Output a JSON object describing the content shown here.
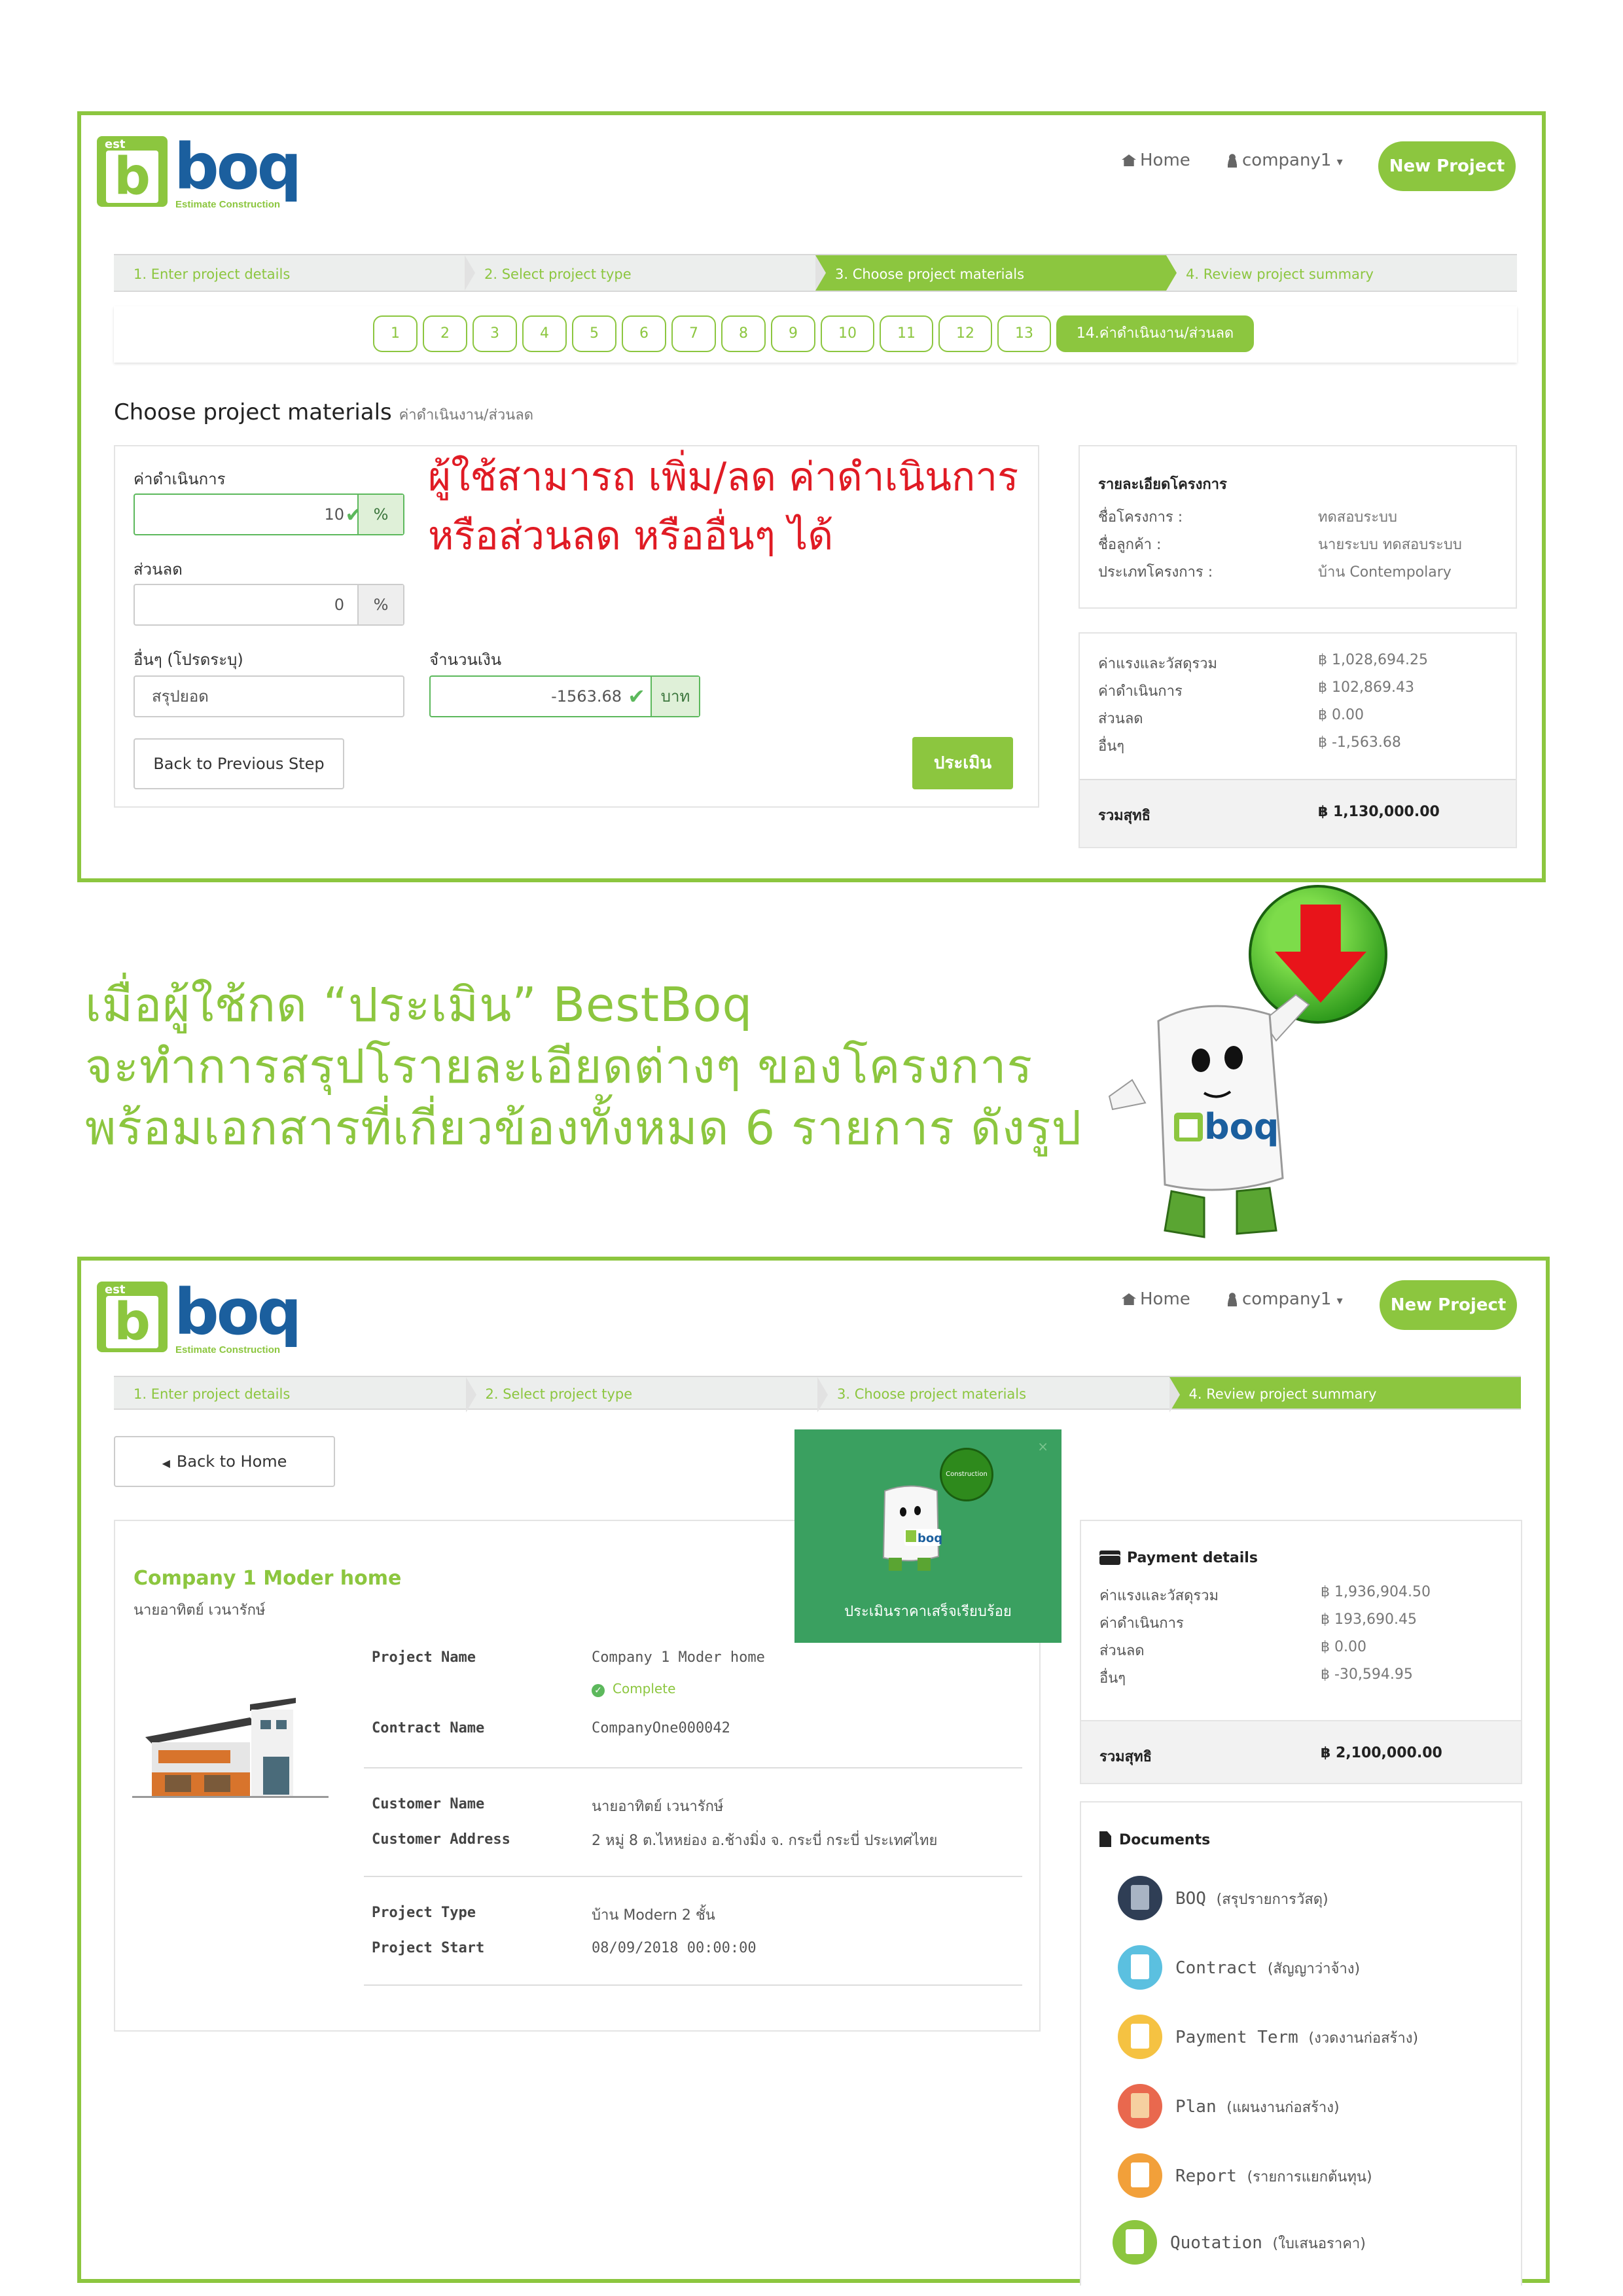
{
  "panel1": {
    "brand": {
      "badge_letter": "b",
      "badge_top": "est",
      "word": "boq",
      "tagline": "Estimate Construction"
    },
    "nav": {
      "home": "Home",
      "user": "company1",
      "user_caret": "▾",
      "new_project": "New Project"
    },
    "steps": [
      "1. Enter project details",
      "2. Select project type",
      "3. Choose project materials",
      "4. Review project summary"
    ],
    "active_step": 3,
    "pages": [
      "1",
      "2",
      "3",
      "4",
      "5",
      "6",
      "7",
      "8",
      "9",
      "10",
      "11",
      "12",
      "13",
      "14.ค่าดำเนินงาน/ส่วนลด"
    ],
    "active_page": 14,
    "title": "Choose project materials",
    "subtitle": "ค่าดำเนินงาน/ส่วนลด",
    "form": {
      "operation_label": "ค่าดำเนินการ",
      "operation_value": "10",
      "operation_unit": "%",
      "discount_label": "ส่วนลด",
      "discount_value": "0",
      "discount_unit": "%",
      "other_label": "อื่นๆ (โปรดระบุ)",
      "other_value": "สรุปยอด",
      "amount_label": "จำนวนเงิน",
      "amount_value": "-1563.68",
      "amount_unit": "บาท",
      "back_button": "Back to Previous Step",
      "evaluate_button": "ประเมิน"
    },
    "note": [
      "ผู้ใช้สามารถ เพิ่ม/ลด ค่าดำเนินการ",
      "หรือส่วนลด หรืออื่นๆ ได้"
    ],
    "project_info": {
      "heading": "รายละเอียดโครงการ",
      "rows": [
        {
          "k": "ชื่อโครงการ :",
          "v": "ทดสอบระบบ"
        },
        {
          "k": "ชื่อลูกค้า :",
          "v": "นายระบบ ทดสอบระบบ"
        },
        {
          "k": "ประเภทโครงการ :",
          "v": "บ้าน Contempolary"
        }
      ]
    },
    "costs": {
      "rows": [
        {
          "k": "ค่าแรงและวัสดุรวม",
          "v": "฿ 1,028,694.25"
        },
        {
          "k": "ค่าดำเนินการ",
          "v": "฿ 102,869.43"
        },
        {
          "k": "ส่วนลด",
          "v": "฿ 0.00"
        },
        {
          "k": "อื่นๆ",
          "v": "฿ -1,563.68"
        }
      ],
      "total_label": "รวมสุทธิ",
      "total_value": "฿ 1,130,000.00"
    }
  },
  "caption": [
    "เมื่อผู้ใช้กด “ประเมิน” BestBoq",
    "จะทำการสรุปโรายละเอียดต่างๆ ของโครงการ",
    "พร้อมเอกสารที่เกี่ยวข้องทั้งหมด 6 รายการ ดังรูป"
  ],
  "mascot": {
    "brand": "boq",
    "badge": "b"
  },
  "panel2": {
    "brand": {
      "badge_letter": "b",
      "badge_top": "est",
      "word": "boq",
      "tagline": "Estimate Construction"
    },
    "nav": {
      "home": "Home",
      "user": "company1",
      "user_caret": "▾",
      "new_project": "New Project"
    },
    "steps": [
      "1. Enter project details",
      "2. Select project type",
      "3. Choose project materials",
      "4. Review project summary"
    ],
    "active_step": 4,
    "back_home": "Back to Home",
    "toast": {
      "message": "ประเมินราคาเสร็จเรียบร้อย",
      "close": "×",
      "ball_text": "Construction"
    },
    "company": {
      "name": "Company 1 Moder home",
      "owner": "นายอาทิตย์ เวนารักษ์"
    },
    "details": [
      {
        "k": "Project Name",
        "v": "Company 1 Moder home"
      },
      {
        "k": "",
        "v": "Complete"
      },
      {
        "k": "Contract Name",
        "v": "CompanyOne000042"
      },
      {
        "k": "Customer Name",
        "v": "นายอาทิตย์ เวนารักษ์"
      },
      {
        "k": "Customer Address",
        "v": "2 หมู่ 8 ต.ไหหย่อง อ.ช้างมิ่ง จ. กระบี่ กระบี่ ประเทศไทย"
      },
      {
        "k": "Project Type",
        "v": "บ้าน Modern 2 ชั้น"
      },
      {
        "k": "Project Start",
        "v": "08/09/2018 00:00:00"
      }
    ],
    "payment": {
      "heading": "Payment details",
      "rows": [
        {
          "k": "ค่าแรงและวัสดุรวม",
          "v": "฿ 1,936,904.50"
        },
        {
          "k": "ค่าดำเนินการ",
          "v": "฿ 193,690.45"
        },
        {
          "k": "ส่วนลด",
          "v": "฿ 0.00"
        },
        {
          "k": "อื่นๆ",
          "v": "฿ -30,594.95"
        }
      ],
      "total_label": "รวมสุทธิ",
      "total_value": "฿ 2,100,000.00"
    },
    "documents": {
      "heading": "Documents",
      "items": [
        {
          "name": "BOQ",
          "desc": "(สรุปรายการวัสดุ)",
          "color": "#2f3e55",
          "icon": "book-icon"
        },
        {
          "name": "Contract",
          "desc": "(สัญญาว่าจ้าง)",
          "color": "#5bc0e0",
          "icon": "contract-icon"
        },
        {
          "name": "Payment Term",
          "desc": "(งวดงานก่อสร้าง)",
          "color": "#f5c242",
          "icon": "payment-term-icon"
        },
        {
          "name": "Plan",
          "desc": "(แผนงานก่อสร้าง)",
          "color": "#e9684e",
          "icon": "plan-icon"
        },
        {
          "name": "Report",
          "desc": "(รายการแยกต้นทุน)",
          "color": "#f2a03a",
          "icon": "report-icon"
        },
        {
          "name": "Quotation",
          "desc": "(ใบเสนอราคา)",
          "color": "#8cc63f",
          "icon": "quotation-icon"
        }
      ]
    }
  }
}
